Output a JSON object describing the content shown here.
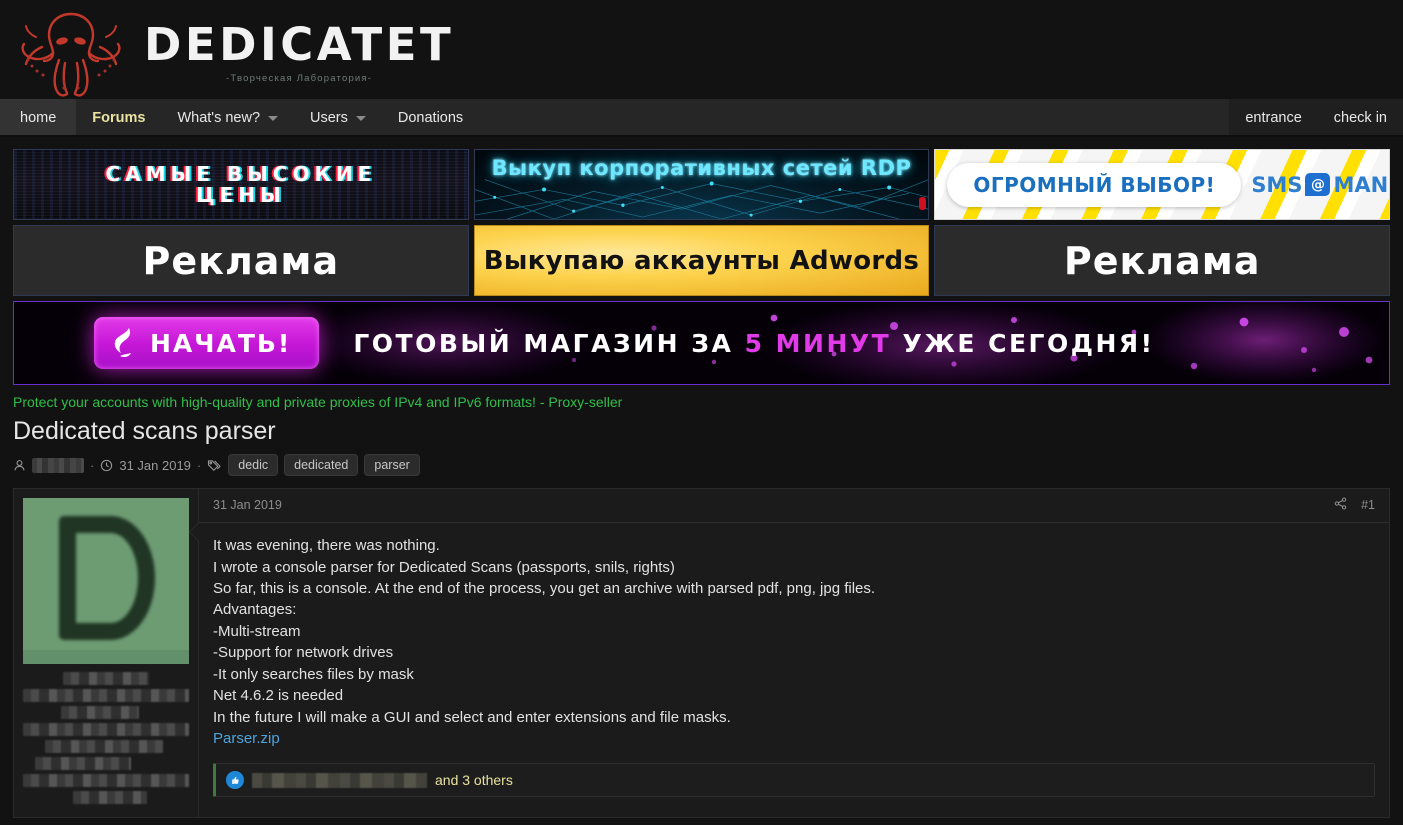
{
  "site": {
    "brand_name": "DEDICATET",
    "brand_tagline": "-Творческая Лаборатория-",
    "logo_icon": "octopus-logo-icon"
  },
  "nav": {
    "left_items": [
      {
        "label": "home",
        "has_caret": false,
        "state": "home"
      },
      {
        "label": "Forums",
        "has_caret": false,
        "state": "active"
      },
      {
        "label": "What's new?",
        "has_caret": true,
        "state": "normal"
      },
      {
        "label": "Users",
        "has_caret": true,
        "state": "normal"
      },
      {
        "label": "Donations",
        "has_caret": false,
        "state": "normal"
      }
    ],
    "right_items": [
      {
        "label": "entrance"
      },
      {
        "label": "check in"
      }
    ]
  },
  "banners": {
    "row1": [
      {
        "id": "highest-prices",
        "text_line1": "САМЫЕ ВЫСОКИЕ",
        "text_line2": "ЦЕНЫ"
      },
      {
        "id": "rdp-networks",
        "text": "Выкуп корпоративных сетей RDP"
      },
      {
        "id": "sms-man",
        "pill_text": "ОГРОМНЫЙ ВЫБОР!",
        "logo_left": "SMS",
        "logo_mark": "@",
        "logo_right": "MAN"
      }
    ],
    "row2": [
      {
        "id": "reklama-left",
        "text": "Реклама"
      },
      {
        "id": "adwords",
        "text": "Выкупаю аккаунты Adwords"
      },
      {
        "id": "reklama-right",
        "text": "Реклама"
      }
    ],
    "wide": {
      "id": "ready-shop",
      "button_label": "НАЧАТЬ!",
      "headline_part1": "ГОТОВЫЙ МАГАЗИН ЗА",
      "headline_highlight": "5 МИНУТ",
      "headline_part2": "УЖЕ СЕГОДНЯ!"
    }
  },
  "notice": {
    "text": "Protect your accounts with high-quality and private proxies of IPv4 and IPv6 formats! - Proxy-seller",
    "color": "#2fbf4a"
  },
  "thread": {
    "title": "Dedicated scans parser",
    "author": "",
    "date": "31 Jan 2019",
    "separator": "·",
    "tags": [
      "dedic",
      "dedicated",
      "parser"
    ]
  },
  "post": {
    "date": "31 Jan 2019",
    "post_number": "#1",
    "share_icon": "share-icon",
    "avatar_letter": "D",
    "body_lines": [
      "It was evening, there was nothing.",
      "I wrote a console parser for Dedicated Scans (passports, snils, rights)",
      "So far, this is a console. At the end of the process, you get an archive with parsed pdf, png, jpg files.",
      "Advantages:",
      "-Multi-stream",
      "-Support for network drives",
      "-It only searches files by mask",
      "Net 4.6.2 is needed",
      "In the future I will make a GUI and select and enter extensions and file masks."
    ],
    "attachment_label": "Parser.zip",
    "reaction": {
      "icon": "thumbs-up-icon",
      "user": "",
      "suffix": "and 3 others"
    }
  },
  "colors": {
    "page_bg": "#121212",
    "nav_bg": "#262626",
    "accent_yellow": "#e9e2a0",
    "link_blue": "#4ea3dd",
    "notice_green": "#2fbf4a"
  }
}
